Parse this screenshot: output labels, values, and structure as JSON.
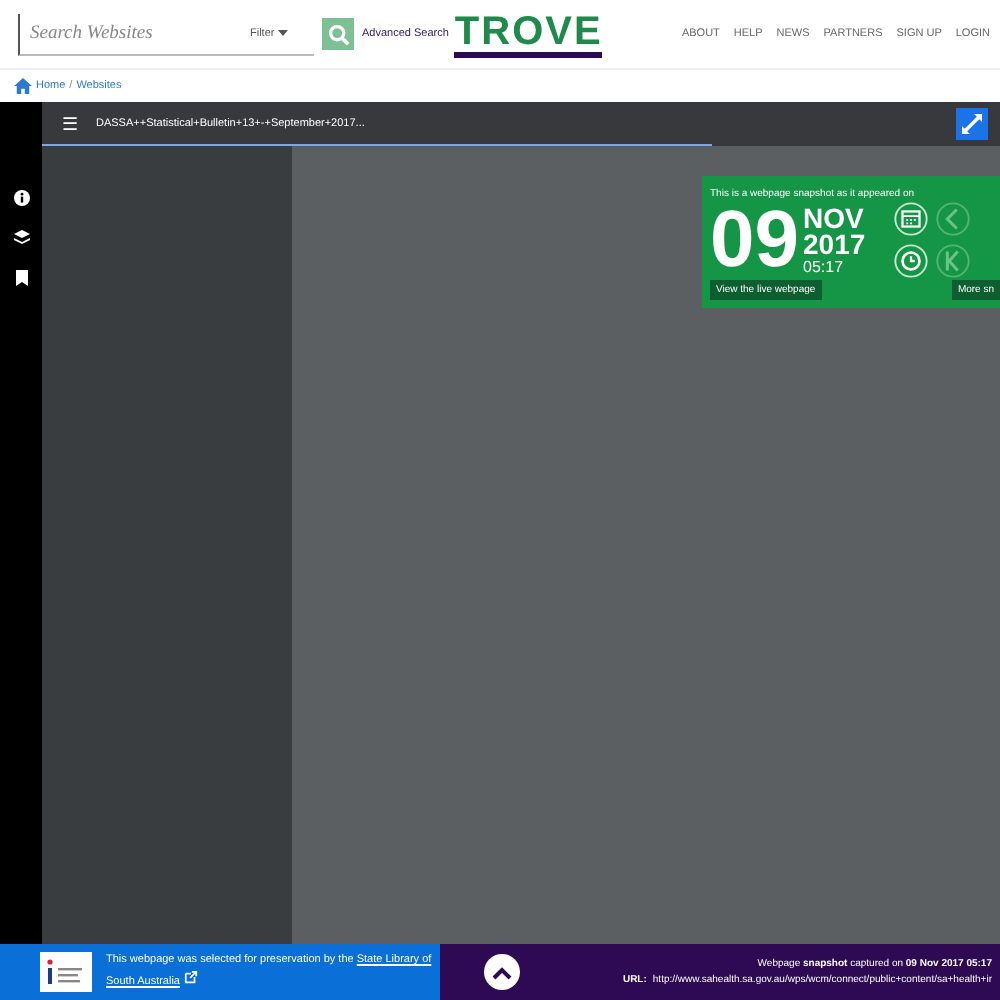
{
  "header": {
    "search": {
      "placeholder": "Search Websites"
    },
    "filter": "Filter",
    "advanced_search": "Advanced Search",
    "logo": "TROVE",
    "nav": [
      "ABOUT",
      "HELP",
      "NEWS",
      "PARTNERS",
      "SIGN UP",
      "LOGIN"
    ]
  },
  "breadcrumb": [
    "Home",
    "/",
    "Websites"
  ],
  "viewer": {
    "menu_icon": "☰",
    "title": "DASSA++Statistical+Bulletin+13+-+September+2017...",
    "progress": {
      "level": 0.7
    },
    "snapshot": {
      "caption": "This is a webpage snapshot as it appeared on",
      "day": "09",
      "month": "NOV",
      "year": "2017",
      "time": "05:17",
      "live_button": "View the live webpage",
      "more_button": "More sn"
    }
  },
  "footer": {
    "selected_text": "This webpage was selected for preservation by the ",
    "library_link": [
      "State Library of",
      "South Australia"
    ],
    "captured_prefix": "Webpage ",
    "captured_bold": "snapshot",
    "captured_suffix": " captured on ",
    "captured_date": "09 Nov 2017 05:17",
    "url_label": "URL:",
    "url": "http://www.sahealth.sa.gov.au/wps/wcm/connect/public+content/sa+health+ir"
  }
}
